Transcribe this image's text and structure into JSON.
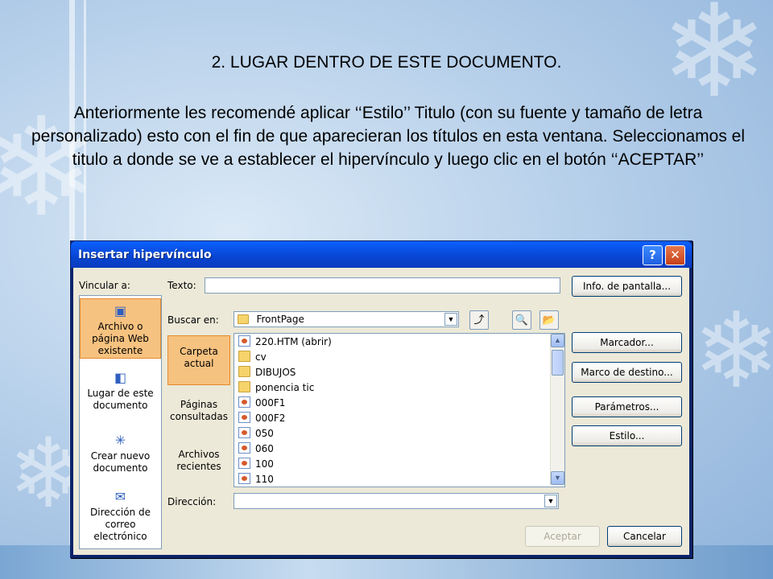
{
  "slide": {
    "title": "2. LUGAR DENTRO DE ESTE DOCUMENTO.",
    "body": " Anteriormente les recomendé aplicar ‘‘Estilo’’ Titulo (con su fuente y tamaño de letra personalizado) esto con el fin de que aparecieran los títulos en esta ventana. Seleccionamos el titulo a donde se ve a establecer el hipervínculo y luego clic en el botón ‘‘ACEPTAR’’"
  },
  "dialog": {
    "title": "Insertar hipervínculo",
    "help_label": "?",
    "close_label": "✕",
    "vincular_label": "Vincular a:",
    "texto_label": "Texto:",
    "texto_value": "",
    "buscar_label": "Buscar en:",
    "buscar_value": "FrontPage",
    "direccion_label": "Dirección:",
    "direccion_value": "",
    "nav": [
      {
        "label": "Archivo o página Web existente",
        "icon": "web-page-icon",
        "selected": true
      },
      {
        "label": "Lugar de este documento",
        "icon": "document-place-icon",
        "selected": false
      },
      {
        "label": "Crear nuevo documento",
        "icon": "new-document-icon",
        "selected": false
      },
      {
        "label": "Dirección de correo electrónico",
        "icon": "email-icon",
        "selected": false
      }
    ],
    "subnav": [
      {
        "label": "Carpeta actual",
        "selected": true
      },
      {
        "label": "Páginas consultadas",
        "selected": false
      },
      {
        "label": "Archivos recientes",
        "selected": false
      }
    ],
    "files": [
      {
        "name": "220.HTM (abrir)",
        "kind": "doc"
      },
      {
        "name": "cv",
        "kind": "folder"
      },
      {
        "name": "DIBUJOS",
        "kind": "folder"
      },
      {
        "name": "ponencia tic",
        "kind": "folder"
      },
      {
        "name": "000F1",
        "kind": "doc"
      },
      {
        "name": "000F2",
        "kind": "doc"
      },
      {
        "name": "050",
        "kind": "doc"
      },
      {
        "name": "060",
        "kind": "doc"
      },
      {
        "name": "100",
        "kind": "doc"
      },
      {
        "name": "110",
        "kind": "doc"
      }
    ],
    "buttons": {
      "info_pantalla": "Info. de pantalla...",
      "marcador": "Marcador...",
      "marco_destino": "Marco de destino...",
      "parametros": "Parámetros...",
      "estilo": "Estilo...",
      "aceptar": "Aceptar",
      "cancelar": "Cancelar"
    }
  }
}
